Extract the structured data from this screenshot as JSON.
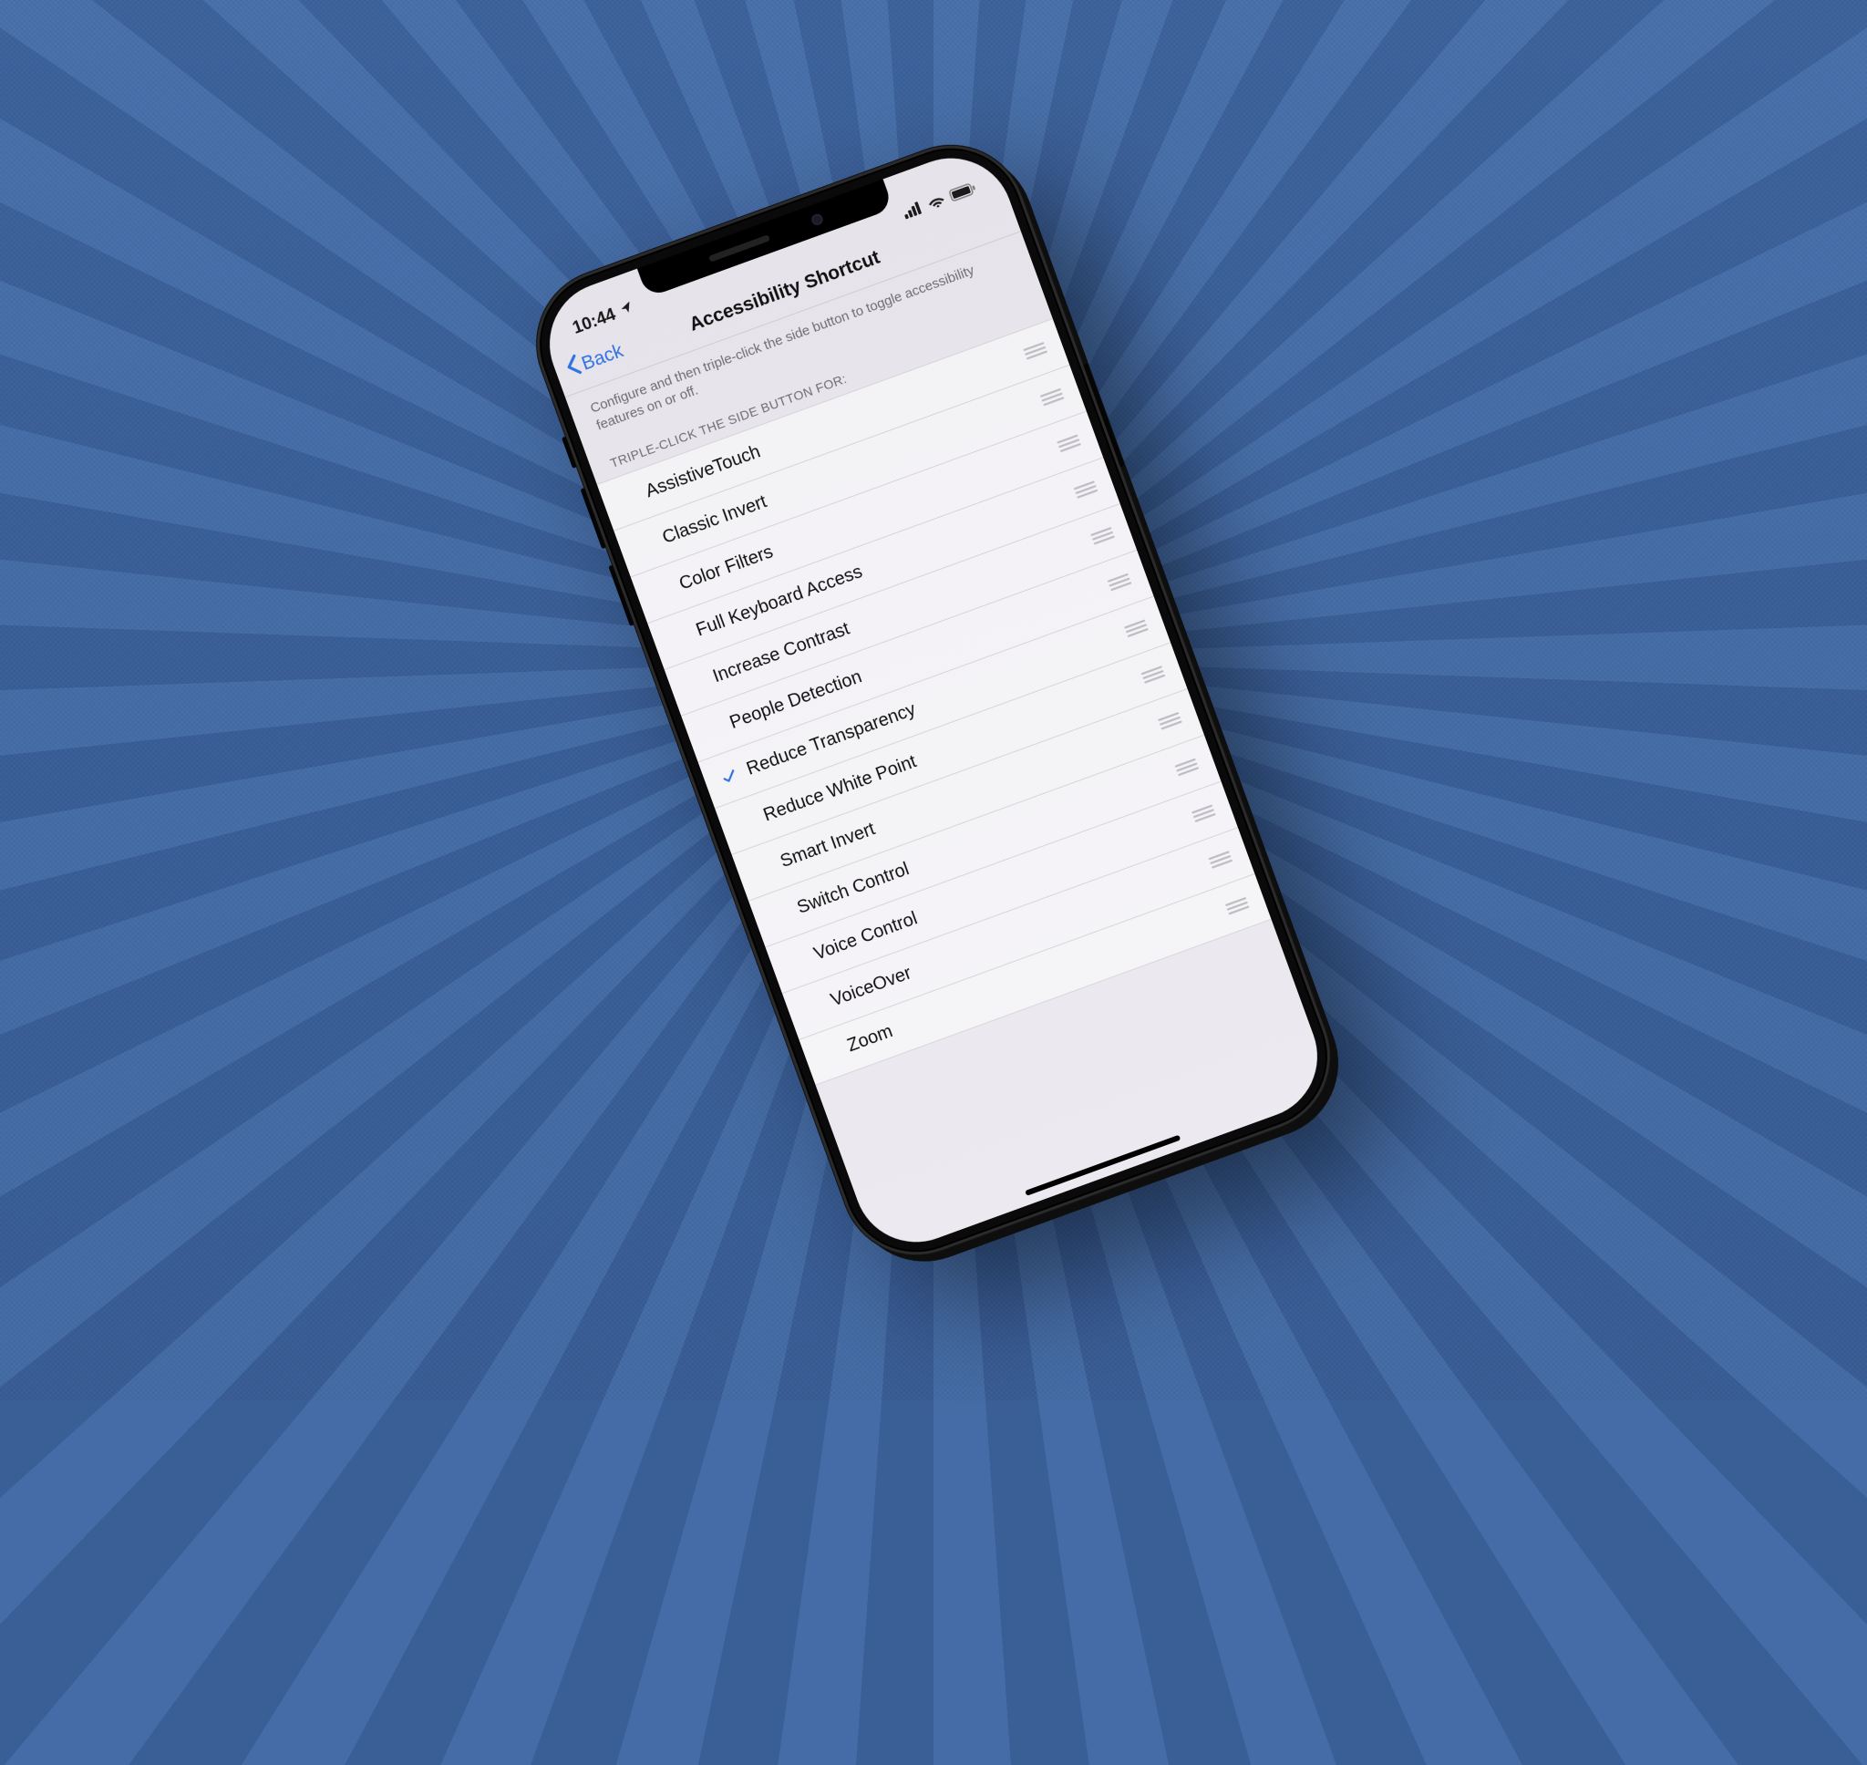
{
  "statusbar": {
    "time": "10:44"
  },
  "nav": {
    "back_label": "Back",
    "title": "Accessibility Shortcut"
  },
  "description": "Configure and then triple-click the side button to toggle accessibility features on or off.",
  "section_header": "TRIPLE-CLICK THE SIDE BUTTON FOR:",
  "items": [
    {
      "label": "AssistiveTouch",
      "checked": false
    },
    {
      "label": "Classic Invert",
      "checked": false
    },
    {
      "label": "Color Filters",
      "checked": false
    },
    {
      "label": "Full Keyboard Access",
      "checked": false
    },
    {
      "label": "Increase Contrast",
      "checked": false
    },
    {
      "label": "People Detection",
      "checked": false
    },
    {
      "label": "Reduce Transparency",
      "checked": true
    },
    {
      "label": "Reduce White Point",
      "checked": false
    },
    {
      "label": "Smart Invert",
      "checked": false
    },
    {
      "label": "Switch Control",
      "checked": false
    },
    {
      "label": "Voice Control",
      "checked": false
    },
    {
      "label": "VoiceOver",
      "checked": false
    },
    {
      "label": "Zoom",
      "checked": false
    }
  ]
}
